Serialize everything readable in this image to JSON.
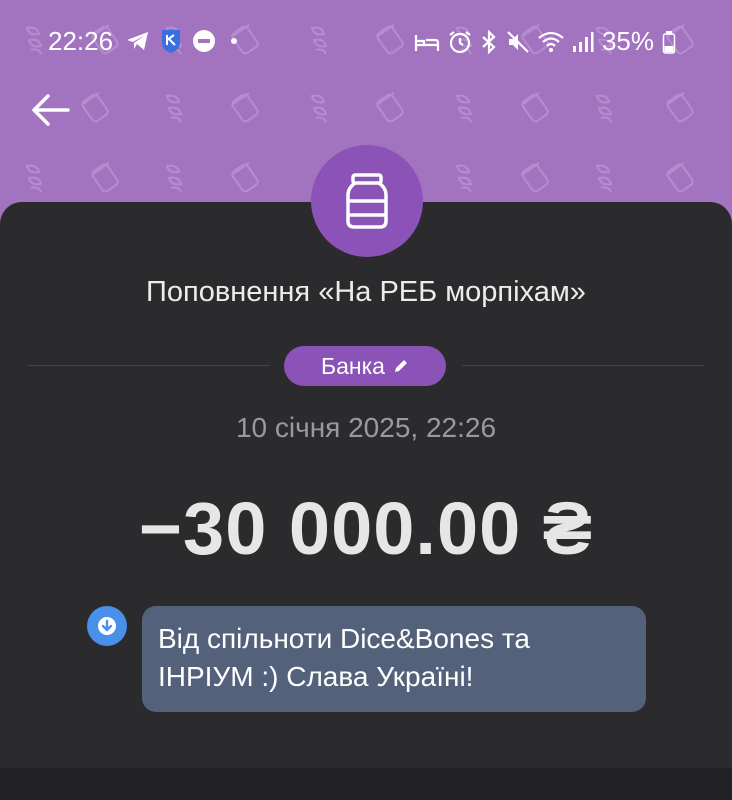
{
  "status_bar": {
    "time": "22:26",
    "left_icons": [
      "telegram-icon",
      "shield-app-icon",
      "do-not-disturb-icon",
      "dot-icon"
    ],
    "right_icons": [
      "bed-icon",
      "alarm-icon",
      "bluetooth-icon",
      "mute-icon",
      "wifi-icon",
      "signal-icon",
      "battery-icon"
    ],
    "battery": "35%"
  },
  "header": {
    "back_icon": "arrow-left-icon"
  },
  "transaction": {
    "icon": "jar-icon",
    "title": "Поповнення «На РЕБ морпіхам»",
    "category": "Банка",
    "category_icon": "pencil-icon",
    "datetime": "10 січня 2025, 22:26",
    "amount": "−30 000.00 ₴",
    "comment_icon": "incoming-arrow-icon",
    "comment": "Від спільноти Dice&Bones та ІНРІУМ :) Слава Україні!"
  },
  "colors": {
    "header_bg": "#a274c0",
    "accent": "#8b52b8",
    "sheet_bg": "#2b2b2d",
    "comment_bubble": "#53627a",
    "comment_icon": "#4a8fe8"
  }
}
